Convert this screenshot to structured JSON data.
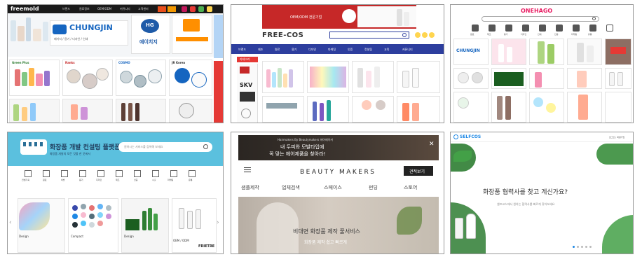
{
  "panel1": {
    "logo": "freemold",
    "nav": [
      "브랜드",
      "원료정보",
      "OEM/ODM",
      "커뮤니티",
      "고객센터"
    ],
    "brand_main": "CHUNGJIN",
    "brand_sub": "패키지 / 용기 / 디자인 / 인쇄",
    "hg": "HG",
    "hg_label": "에이치지",
    "cards": [
      "Green Plus",
      "Ranks",
      "COSMO",
      "JR Korea"
    ]
  },
  "panel2": {
    "banner_text": "OEM/ODM 전문기업",
    "logo": "FREE-COS",
    "search_placeholder": "",
    "menu": [
      "브랜드",
      "제조",
      "원료",
      "용기",
      "디자인",
      "마케팅",
      "인증",
      "컨설팅",
      "교육",
      "커뮤니티"
    ],
    "skv": "SKV",
    "side_label": "카테고리"
  },
  "panel3": {
    "logo": "ONEHAGO",
    "brand_card": "CHUNGJIN",
    "icons": [
      "원료",
      "제조",
      "용기",
      "디자인",
      "인쇄",
      "인증",
      "마케팅",
      "유통"
    ]
  },
  "panel4": {
    "title": "화장품 개발 컨설팅 플랫폼",
    "subtitle": "화장품 개발의 모든 것을 한 곳에서",
    "search_placeholder": "원하시는 서비스를 검색해 보세요",
    "icons": [
      "컨셉기획",
      "원료",
      "처방",
      "용기",
      "디자인",
      "제조",
      "인증",
      "수출",
      "마케팅",
      "유통"
    ],
    "cards": [
      "Design",
      "Compact",
      "Design",
      "OEM / ODM"
    ],
    "brand": "FRIETRE"
  },
  "panel5": {
    "ad_line1": "Hairmakers By Beautymakers 헤어메이커",
    "ad_line2": "내 두피와 모발타입에",
    "ad_line3": "꼭 맞는 헤어제품을 찾아라!",
    "close": "✕",
    "logo": "BEAUTY MAKERS",
    "cta": "견적보기",
    "tabs": [
      "샘플제작",
      "업체검색",
      "스페이스",
      "펀딩",
      "스토어"
    ],
    "hero_title": "비대면 화장품 제작 풀서비스",
    "hero_sub": "화장품 제작 쉽고 빠르게"
  },
  "panel6": {
    "logo": "SELFCOS",
    "login": "로그인 | 회원가입",
    "headline": "화장품 협력사를 찾고 계신가요?",
    "sub": "셀프코스에서 원하는 협력사를 빠르게 찾아보세요"
  }
}
